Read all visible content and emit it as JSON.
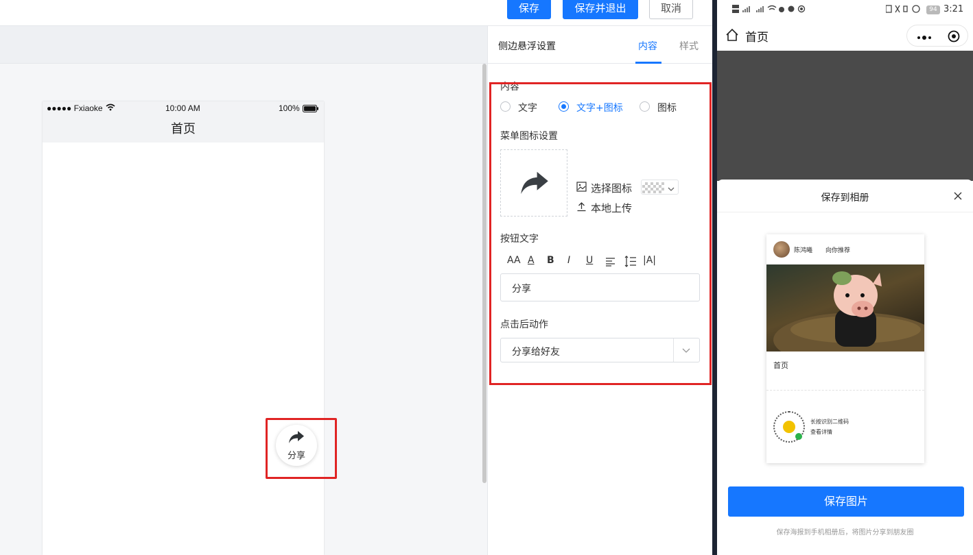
{
  "toolbar": {
    "save_label": "保存",
    "save_exit_label": "保存并退出",
    "cancel_label": "取消"
  },
  "preview_phone": {
    "carrier": "●●●●● Fxiaoke",
    "time": "10:00 AM",
    "battery": "100%",
    "page_title": "首页",
    "float_button_label": "分享",
    "float_button_icon": "share-arrow-icon"
  },
  "settings_panel": {
    "title": "侧边悬浮设置",
    "tabs": [
      {
        "label": "内容",
        "active": true
      },
      {
        "label": "样式",
        "active": false
      }
    ],
    "content_section_label": "内容",
    "content_options": [
      {
        "label": "文字",
        "selected": false
      },
      {
        "label": "文字+图标",
        "selected": true
      },
      {
        "label": "图标",
        "selected": false
      }
    ],
    "menu_icon_section_label": "菜单图标设置",
    "select_icon_label": "选择图标",
    "upload_label": "本地上传",
    "button_text_section_label": "按钮文字",
    "text_toolbar_icons": [
      "font-size-icon",
      "font-color-icon",
      "bold-icon",
      "italic-icon",
      "underline-icon",
      "align-icon",
      "line-height-icon",
      "letter-spacing-icon"
    ],
    "text_toolbar_glyphs": {
      "font_size": "AA",
      "font_color": "A",
      "bold": "B",
      "italic": "I",
      "underline": "U",
      "letter_spacing": "|A|"
    },
    "button_text_value": "分享",
    "action_section_label": "点击后动作",
    "action_value": "分享给好友"
  },
  "mobile_screen": {
    "status_time": "3:21",
    "battery_level": "94",
    "nav_title": "首页",
    "sheet_title": "保存到相册",
    "poster": {
      "user_name": "陈鸿曦",
      "recommend_text": "向你推荐",
      "page_name": "首页",
      "qr_text_1": "长按识别二维码",
      "qr_text_2": "查看详情"
    },
    "save_button_label": "保存图片",
    "hint_text": "保存海报到手机相册后，将图片分享到朋友圈"
  },
  "colors": {
    "primary": "#1677ff",
    "highlight_outline": "#e02424",
    "dark_overlay": "#4a4a4a"
  }
}
